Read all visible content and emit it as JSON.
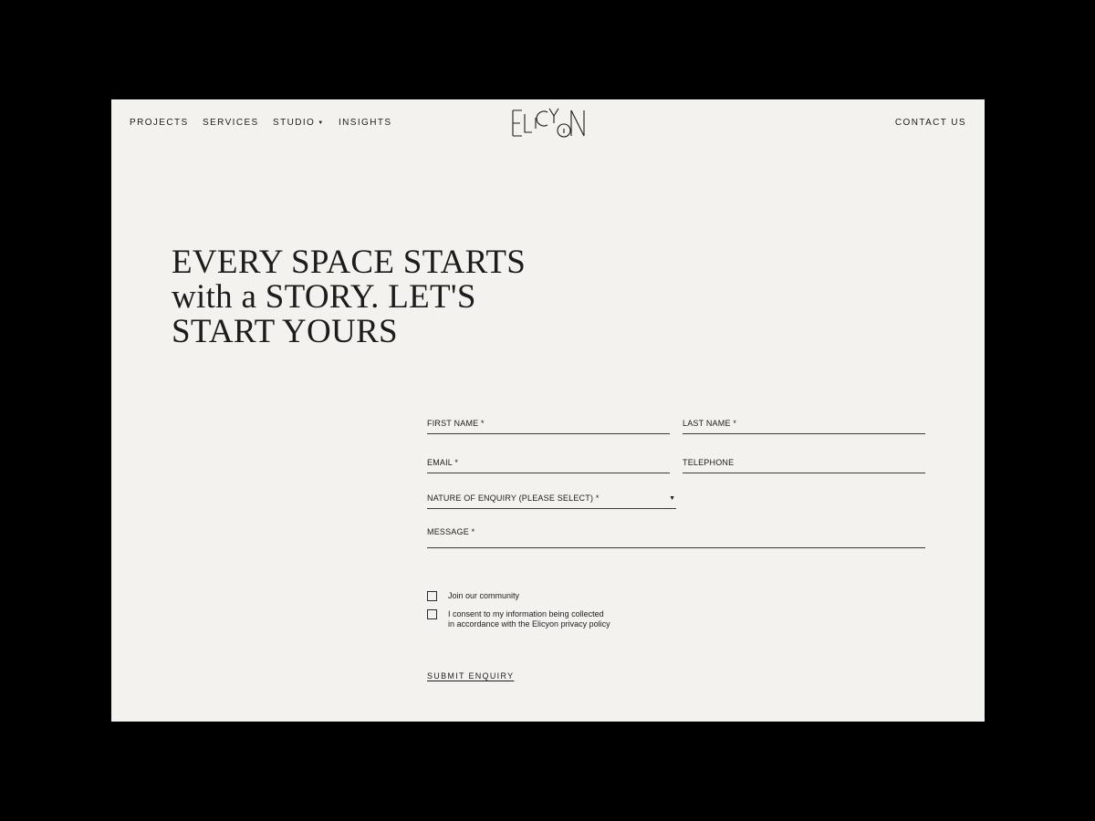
{
  "nav": {
    "projects": "PROJECTS",
    "services": "SERVICES",
    "studio": "STUDIO",
    "insights": "INSIGHTS",
    "contact": "CONTACT US"
  },
  "logo": {
    "text": "ELICYON"
  },
  "headline": {
    "line1": "EVERY SPACE STARTS",
    "line2": "with a STORY. LET'S",
    "line3": "START YOURS"
  },
  "form": {
    "first_name": "FIRST NAME *",
    "last_name": "LAST NAME *",
    "email": "EMAIL *",
    "telephone": "TELEPHONE",
    "nature": "NATURE OF ENQUIRY (PLEASE SELECT) *",
    "message": "MESSAGE *",
    "community": "Join our community",
    "consent_line1": "I consent to my information being collected",
    "consent_line2": "in accordance with the Elicyon privacy policy",
    "submit": "SUBMIT ENQUIRY"
  },
  "icons": {
    "studio_caret": "caret-down-icon",
    "select_caret": "caret-down-icon"
  },
  "colors": {
    "background": "#000000",
    "page": "#f3f2ee",
    "text": "#1c1c1c"
  }
}
